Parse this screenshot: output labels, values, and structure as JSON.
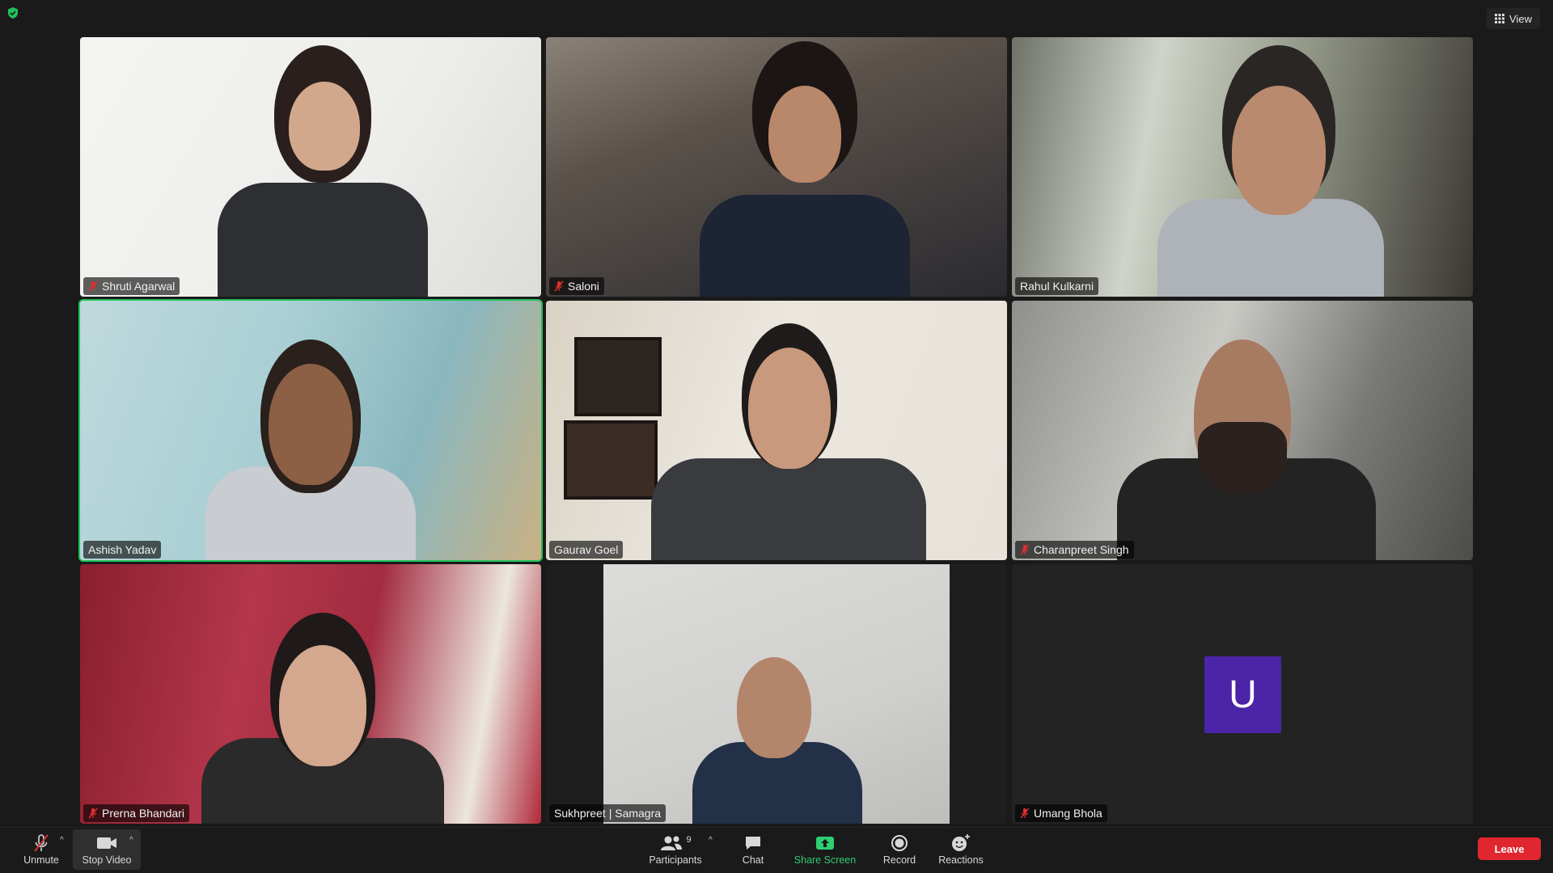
{
  "header": {
    "view_label": "View"
  },
  "participants": [
    {
      "name": "Shruti Agarwal",
      "muted": true
    },
    {
      "name": "Saloni",
      "muted": true
    },
    {
      "name": "Rahul Kulkarni",
      "muted": false
    },
    {
      "name": "Ashish Yadav",
      "muted": false,
      "active_speaker": true
    },
    {
      "name": "Gaurav Goel",
      "muted": false
    },
    {
      "name": "Charanpreet Singh",
      "muted": true
    },
    {
      "name": "Prerna Bhandari",
      "muted": true
    },
    {
      "name": "Sukhpreet | Samagra",
      "muted": false
    },
    {
      "name": "Umang Bhola",
      "muted": true,
      "avatar_letter": "U"
    }
  ],
  "toolbar": {
    "unmute": "Unmute",
    "stop_video": "Stop Video",
    "participants": "Participants",
    "participants_count": "9",
    "chat": "Chat",
    "share_screen": "Share Screen",
    "record": "Record",
    "reactions": "Reactions",
    "leave": "Leave"
  },
  "colors": {
    "active_speaker_border": "#23c15b",
    "share_screen_green": "#2ece72",
    "leave_red": "#e0272f",
    "avatar_purple": "#4b24a7"
  }
}
